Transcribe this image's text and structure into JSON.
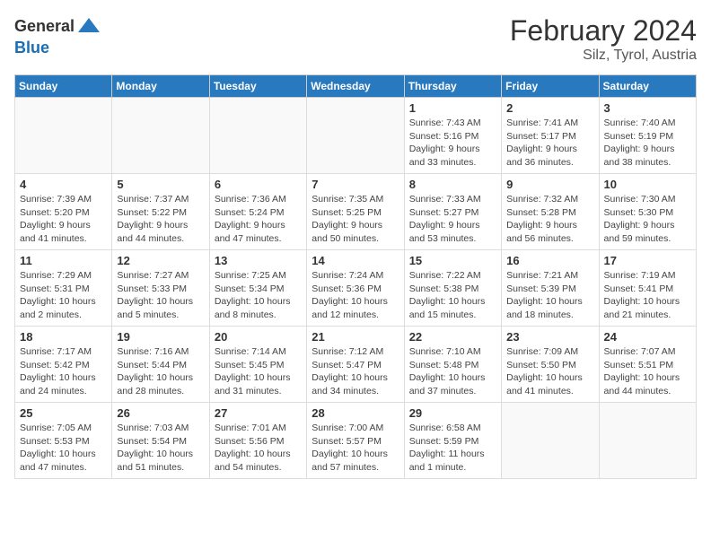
{
  "logo": {
    "general": "General",
    "blue": "Blue"
  },
  "title": "February 2024",
  "location": "Silz, Tyrol, Austria",
  "days_of_week": [
    "Sunday",
    "Monday",
    "Tuesday",
    "Wednesday",
    "Thursday",
    "Friday",
    "Saturday"
  ],
  "weeks": [
    [
      {
        "day": "",
        "info": ""
      },
      {
        "day": "",
        "info": ""
      },
      {
        "day": "",
        "info": ""
      },
      {
        "day": "",
        "info": ""
      },
      {
        "day": "1",
        "info": "Sunrise: 7:43 AM\nSunset: 5:16 PM\nDaylight: 9 hours\nand 33 minutes."
      },
      {
        "day": "2",
        "info": "Sunrise: 7:41 AM\nSunset: 5:17 PM\nDaylight: 9 hours\nand 36 minutes."
      },
      {
        "day": "3",
        "info": "Sunrise: 7:40 AM\nSunset: 5:19 PM\nDaylight: 9 hours\nand 38 minutes."
      }
    ],
    [
      {
        "day": "4",
        "info": "Sunrise: 7:39 AM\nSunset: 5:20 PM\nDaylight: 9 hours\nand 41 minutes."
      },
      {
        "day": "5",
        "info": "Sunrise: 7:37 AM\nSunset: 5:22 PM\nDaylight: 9 hours\nand 44 minutes."
      },
      {
        "day": "6",
        "info": "Sunrise: 7:36 AM\nSunset: 5:24 PM\nDaylight: 9 hours\nand 47 minutes."
      },
      {
        "day": "7",
        "info": "Sunrise: 7:35 AM\nSunset: 5:25 PM\nDaylight: 9 hours\nand 50 minutes."
      },
      {
        "day": "8",
        "info": "Sunrise: 7:33 AM\nSunset: 5:27 PM\nDaylight: 9 hours\nand 53 minutes."
      },
      {
        "day": "9",
        "info": "Sunrise: 7:32 AM\nSunset: 5:28 PM\nDaylight: 9 hours\nand 56 minutes."
      },
      {
        "day": "10",
        "info": "Sunrise: 7:30 AM\nSunset: 5:30 PM\nDaylight: 9 hours\nand 59 minutes."
      }
    ],
    [
      {
        "day": "11",
        "info": "Sunrise: 7:29 AM\nSunset: 5:31 PM\nDaylight: 10 hours\nand 2 minutes."
      },
      {
        "day": "12",
        "info": "Sunrise: 7:27 AM\nSunset: 5:33 PM\nDaylight: 10 hours\nand 5 minutes."
      },
      {
        "day": "13",
        "info": "Sunrise: 7:25 AM\nSunset: 5:34 PM\nDaylight: 10 hours\nand 8 minutes."
      },
      {
        "day": "14",
        "info": "Sunrise: 7:24 AM\nSunset: 5:36 PM\nDaylight: 10 hours\nand 12 minutes."
      },
      {
        "day": "15",
        "info": "Sunrise: 7:22 AM\nSunset: 5:38 PM\nDaylight: 10 hours\nand 15 minutes."
      },
      {
        "day": "16",
        "info": "Sunrise: 7:21 AM\nSunset: 5:39 PM\nDaylight: 10 hours\nand 18 minutes."
      },
      {
        "day": "17",
        "info": "Sunrise: 7:19 AM\nSunset: 5:41 PM\nDaylight: 10 hours\nand 21 minutes."
      }
    ],
    [
      {
        "day": "18",
        "info": "Sunrise: 7:17 AM\nSunset: 5:42 PM\nDaylight: 10 hours\nand 24 minutes."
      },
      {
        "day": "19",
        "info": "Sunrise: 7:16 AM\nSunset: 5:44 PM\nDaylight: 10 hours\nand 28 minutes."
      },
      {
        "day": "20",
        "info": "Sunrise: 7:14 AM\nSunset: 5:45 PM\nDaylight: 10 hours\nand 31 minutes."
      },
      {
        "day": "21",
        "info": "Sunrise: 7:12 AM\nSunset: 5:47 PM\nDaylight: 10 hours\nand 34 minutes."
      },
      {
        "day": "22",
        "info": "Sunrise: 7:10 AM\nSunset: 5:48 PM\nDaylight: 10 hours\nand 37 minutes."
      },
      {
        "day": "23",
        "info": "Sunrise: 7:09 AM\nSunset: 5:50 PM\nDaylight: 10 hours\nand 41 minutes."
      },
      {
        "day": "24",
        "info": "Sunrise: 7:07 AM\nSunset: 5:51 PM\nDaylight: 10 hours\nand 44 minutes."
      }
    ],
    [
      {
        "day": "25",
        "info": "Sunrise: 7:05 AM\nSunset: 5:53 PM\nDaylight: 10 hours\nand 47 minutes."
      },
      {
        "day": "26",
        "info": "Sunrise: 7:03 AM\nSunset: 5:54 PM\nDaylight: 10 hours\nand 51 minutes."
      },
      {
        "day": "27",
        "info": "Sunrise: 7:01 AM\nSunset: 5:56 PM\nDaylight: 10 hours\nand 54 minutes."
      },
      {
        "day": "28",
        "info": "Sunrise: 7:00 AM\nSunset: 5:57 PM\nDaylight: 10 hours\nand 57 minutes."
      },
      {
        "day": "29",
        "info": "Sunrise: 6:58 AM\nSunset: 5:59 PM\nDaylight: 11 hours\nand 1 minute."
      },
      {
        "day": "",
        "info": ""
      },
      {
        "day": "",
        "info": ""
      }
    ]
  ]
}
